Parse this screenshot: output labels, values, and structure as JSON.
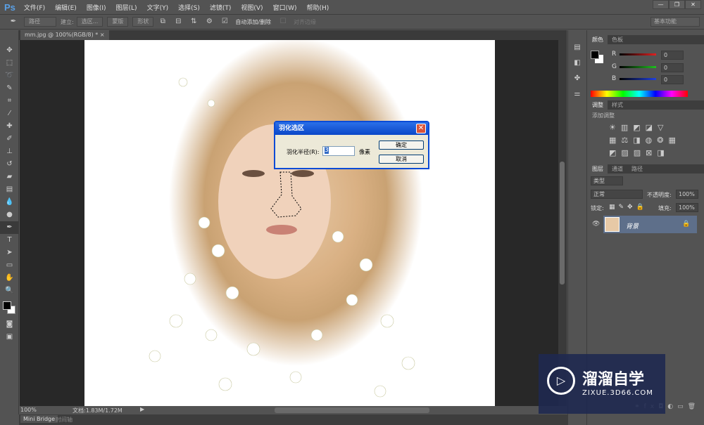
{
  "app": {
    "logo": "Ps"
  },
  "menu": [
    "文件(F)",
    "编辑(E)",
    "图像(I)",
    "图层(L)",
    "文字(Y)",
    "选择(S)",
    "滤镜(T)",
    "视图(V)",
    "窗口(W)",
    "帮助(H)"
  ],
  "window_buttons": {
    "minimize": "—",
    "restore": "❐",
    "close": "✕"
  },
  "options": {
    "path_mode": "路径",
    "build_label": "建立:",
    "selection": "选区...",
    "mask": "蒙版",
    "shape": "形状",
    "auto_add_delete": "自动添加/删除",
    "auto_add_checked": true,
    "align_edges": "对齐边缘",
    "align_checked": false,
    "workspace": "基本功能"
  },
  "document": {
    "tab": "mm.jpg @ 100%(RGB/8) *",
    "close": "×"
  },
  "status": {
    "zoom": "100%",
    "doc_info": "文档:1.83M/1.72M"
  },
  "bottom_tabs": [
    "Mini Bridge",
    "时间轴"
  ],
  "dialog": {
    "title": "羽化选区",
    "radius_label": "羽化半径(R):",
    "radius_value": "3",
    "unit": "像素",
    "ok": "确定",
    "cancel": "取消"
  },
  "color_panel": {
    "tabs": [
      "颜色",
      "色板"
    ],
    "channels": [
      {
        "label": "R",
        "value": "0",
        "color": "#e02020"
      },
      {
        "label": "G",
        "value": "0",
        "color": "#20c020"
      },
      {
        "label": "B",
        "value": "0",
        "color": "#2040e0"
      }
    ],
    "foreground": "#000000",
    "background": "#ffffff"
  },
  "adjust_panel": {
    "tabs": [
      "调整",
      "样式"
    ],
    "label": "添加调整"
  },
  "layers_panel": {
    "tabs": [
      "图层",
      "通道",
      "路径"
    ],
    "filter": "类型",
    "blend_mode": "正常",
    "opacity_label": "不透明度:",
    "opacity": "100%",
    "lock_label": "锁定:",
    "fill_label": "填充:",
    "fill": "100%",
    "layers": [
      {
        "name": "背景",
        "visible": true,
        "locked": true
      }
    ]
  },
  "watermark": {
    "name": "溜溜自学",
    "url": "ZIXUE.3D66.COM"
  }
}
